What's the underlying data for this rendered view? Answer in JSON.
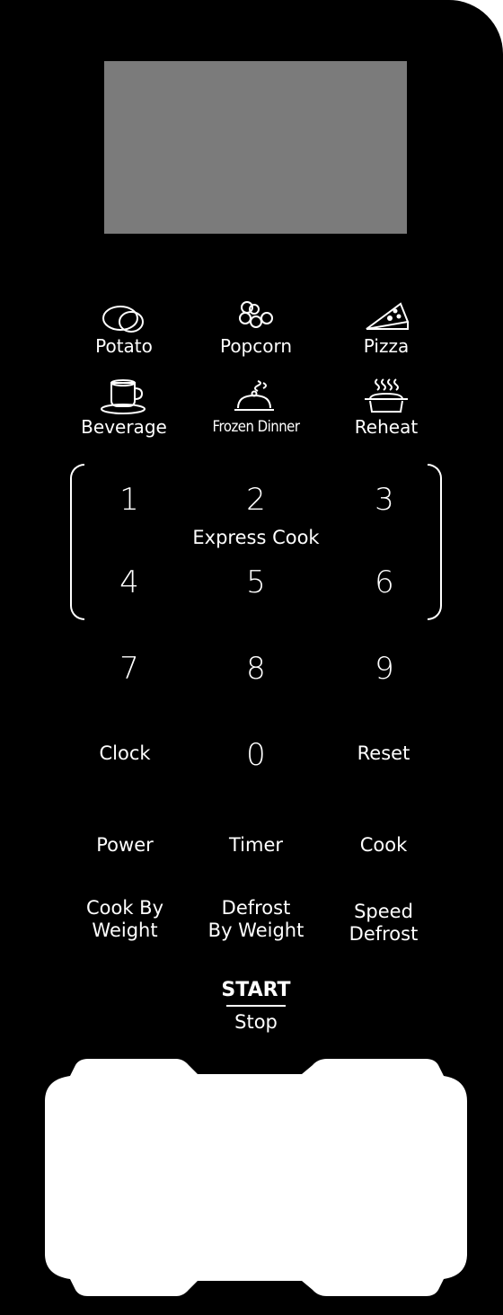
{
  "presets": [
    {
      "label": "Potato",
      "icon": "potato-icon"
    },
    {
      "label": "Popcorn",
      "icon": "popcorn-icon"
    },
    {
      "label": "Pizza",
      "icon": "pizza-icon"
    },
    {
      "label": "Beverage",
      "icon": "beverage-icon"
    },
    {
      "label": "Frozen Dinner",
      "icon": "frozen-dinner-icon"
    },
    {
      "label": "Reheat",
      "icon": "reheat-icon"
    }
  ],
  "keypad": {
    "express_label": "Express Cook",
    "digits": [
      "1",
      "2",
      "3",
      "4",
      "5",
      "6",
      "7",
      "8",
      "9",
      "0"
    ]
  },
  "functions": {
    "clock": "Clock",
    "reset": "Reset",
    "power": "Power",
    "timer": "Timer",
    "cook": "Cook",
    "cook_by_weight": [
      "Cook By",
      "Weight"
    ],
    "defrost_by_weight": [
      "Defrost",
      "By Weight"
    ],
    "speed_defrost": [
      "Speed",
      "Defrost"
    ]
  },
  "start_stop": {
    "start": "START",
    "stop": "Stop"
  },
  "colors": {
    "panel": "#000000",
    "display": "#7b7b7b",
    "text": "#ffffff",
    "window": "#ffffff"
  }
}
